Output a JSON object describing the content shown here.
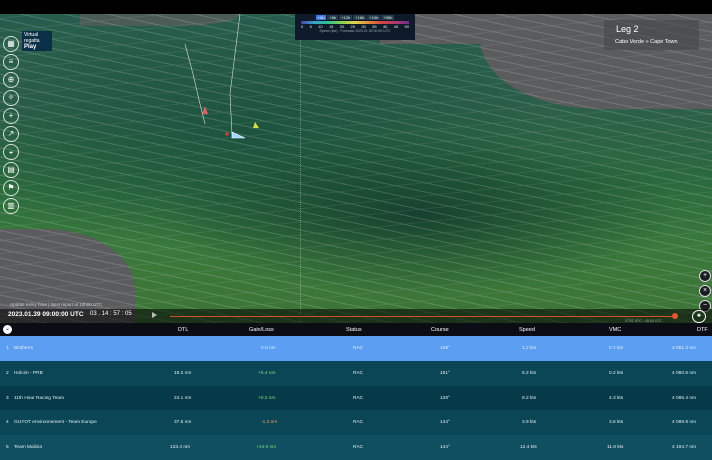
{
  "header": {
    "logo_line1": "Virtual",
    "logo_line2": "regatta",
    "logo_line3": "Play"
  },
  "toolbar_icons": [
    "layers-icon",
    "lines-icon",
    "crosshair-icon",
    "compass-icon",
    "plus-icon",
    "route-icon",
    "shield-icon",
    "chart-icon",
    "flag-icon",
    "stats-icon"
  ],
  "legend": {
    "tabs": [
      "+0h",
      "+6h",
      "+12h",
      "+18h",
      "+24h",
      "+36h"
    ],
    "active_tab": "+0h",
    "ticks": [
      "0",
      "5",
      "10",
      "15",
      "20",
      "25",
      "30",
      "35",
      "40",
      "45",
      "50"
    ],
    "sub": "Speed (kts) · Forecast 2023.01.39 00:00 UTC"
  },
  "leg": {
    "title": "Leg 2",
    "route": "Cabo Verde » Cape Town"
  },
  "update_note": "Update every hour | Next report at 10h00 UTC",
  "timebar": {
    "datetime": "2023.01.39 09:00:00 UTC",
    "countdown": "03 . 14 : 57 : 05",
    "track_label": "07/01 UTC - 00:00 UTC"
  },
  "map_buttons": [
    "+",
    "×",
    "−"
  ],
  "table": {
    "collapse_icon": "chevron-down-icon",
    "columns": [
      "DTL",
      "Gain/Loss",
      "Status",
      "Course",
      "Speed",
      "VMC",
      "DTF"
    ],
    "rows": [
      {
        "rank": "1",
        "name": "Biotherm",
        "dtl": "",
        "gain": "0.0 nm",
        "status": "RAC",
        "course": "158°",
        "speed": "1.2 kts",
        "vmc": "0.7 kts",
        "dtf": "4 061.3 nm",
        "selected": true
      },
      {
        "rank": "2",
        "name": "Holcim - PRB",
        "dtl": "19.2 nm",
        "gain": "+0.4 nm",
        "status": "RAC",
        "course": "161°",
        "speed": "5.2 kts",
        "vmc": "0.2 kts",
        "dtf": "4 080.5 nm"
      },
      {
        "rank": "3",
        "name": "11th Hour Racing Team",
        "dtl": "24.1 nm",
        "gain": "+0.2 nm",
        "status": "RAC",
        "course": "128°",
        "speed": "8.2 kts",
        "vmc": "4.3 kts",
        "dtf": "4 085.4 nm"
      },
      {
        "rank": "4",
        "name": "GUYOT environnement - Team Europe",
        "dtl": "37.5 nm",
        "gain": "-1.3 nm",
        "status": "RAC",
        "course": "144°",
        "speed": "3.9 kts",
        "vmc": "3.6 kts",
        "dtf": "4 098.8 nm"
      },
      {
        "rank": "5",
        "name": "Team Malizia",
        "dtl": "133.4 nm",
        "gain": "+14.9 nm",
        "status": "RAC",
        "course": "144°",
        "speed": "12.4 kts",
        "vmc": "11.8 kts",
        "dtf": "4 194.7 nm"
      }
    ]
  },
  "colors": {
    "selected_row": "#5b9ef2",
    "positive_gain": "#7be07b",
    "negative_gain": "#ff9a55",
    "timeline": "#d3522b"
  }
}
